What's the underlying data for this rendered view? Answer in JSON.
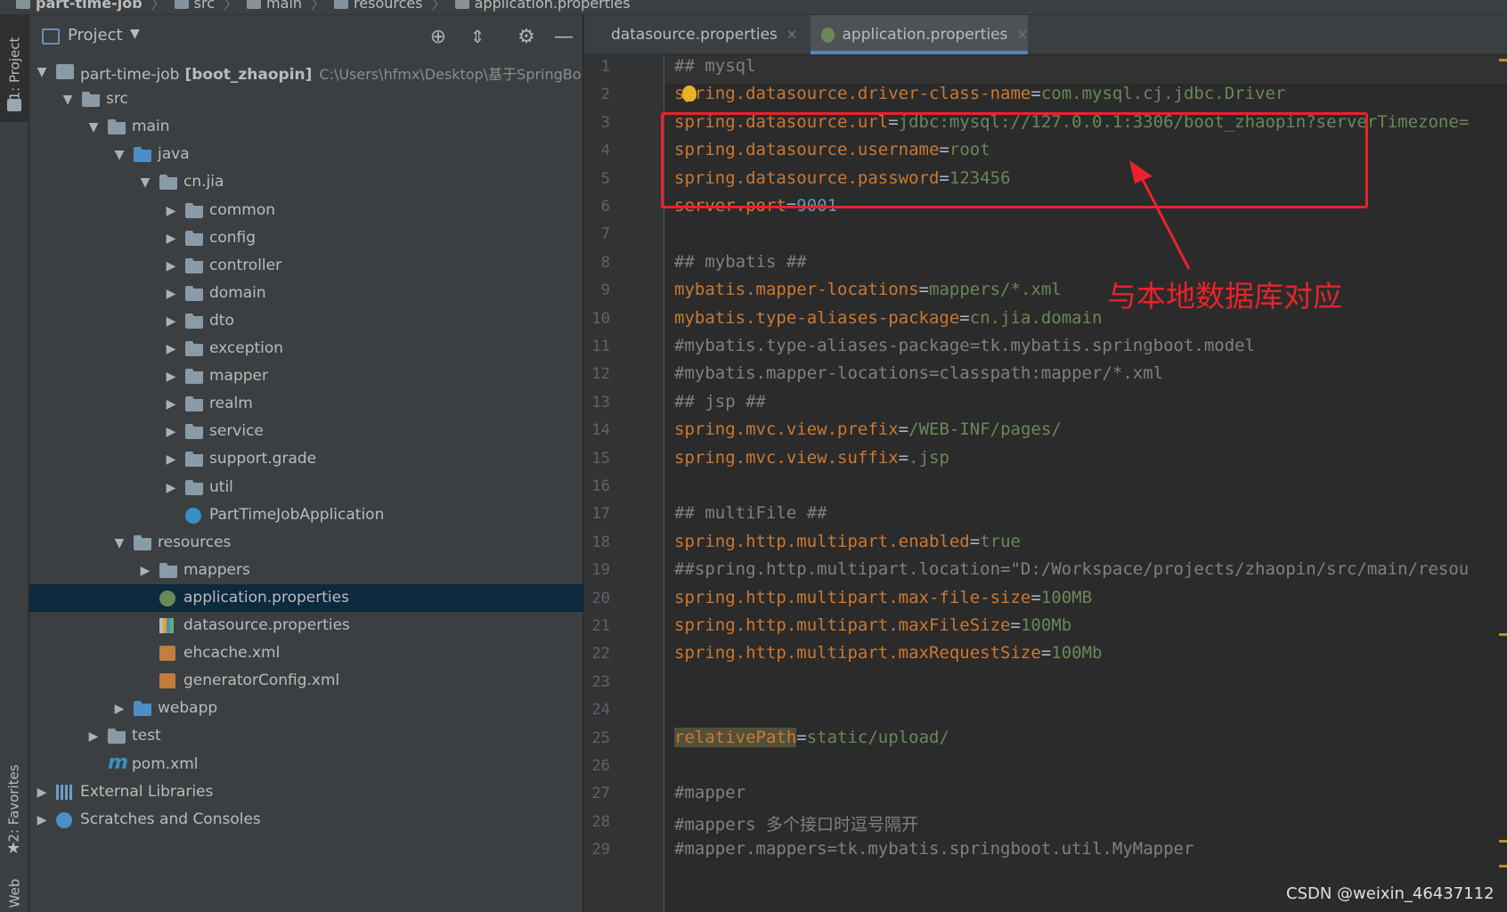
{
  "breadcrumb": {
    "items": [
      "part-time-job",
      "src",
      "main",
      "resources",
      "application.properties"
    ]
  },
  "left_strip": {
    "project_tab": "1: Project",
    "favorites_tab": "2: Favorites",
    "web_tab": "Web"
  },
  "project_panel": {
    "title": "Project",
    "buttons": [
      "locate-icon",
      "collapse-icon",
      "gear-icon",
      "minimize-icon"
    ],
    "tree": [
      {
        "label": "part-time-job",
        "bold": "[boot_zhaopin]",
        "path": "C:\\Users\\hfmx\\Desktop\\基于SpringBo"
      },
      {
        "label": "src"
      },
      {
        "label": "main"
      },
      {
        "label": "java"
      },
      {
        "label": "cn.jia"
      },
      {
        "label": "common"
      },
      {
        "label": "config"
      },
      {
        "label": "controller"
      },
      {
        "label": "domain"
      },
      {
        "label": "dto"
      },
      {
        "label": "exception"
      },
      {
        "label": "mapper"
      },
      {
        "label": "realm"
      },
      {
        "label": "service"
      },
      {
        "label": "support.grade"
      },
      {
        "label": "util"
      },
      {
        "label": "PartTimeJobApplication"
      },
      {
        "label": "resources"
      },
      {
        "label": "mappers"
      },
      {
        "label": "application.properties"
      },
      {
        "label": "datasource.properties"
      },
      {
        "label": "ehcache.xml"
      },
      {
        "label": "generatorConfig.xml"
      },
      {
        "label": "webapp"
      },
      {
        "label": "test"
      },
      {
        "label": "pom.xml"
      },
      {
        "label": "External Libraries"
      },
      {
        "label": "Scratches and Consoles"
      }
    ]
  },
  "tabs": [
    {
      "label": "datasource.properties",
      "active": false
    },
    {
      "label": "application.properties",
      "active": true
    }
  ],
  "editor": {
    "lines": [
      [
        {
          "t": "c",
          "s": "## mysql"
        }
      ],
      [
        {
          "t": "k",
          "s": "spring.datasource.driver-class-name"
        },
        {
          "t": "eq",
          "s": "="
        },
        {
          "t": "v",
          "s": "com.mysql.cj.jdbc.Driver"
        }
      ],
      [
        {
          "t": "k",
          "s": "spring.datasource.url"
        },
        {
          "t": "eq",
          "s": "="
        },
        {
          "t": "v",
          "s": "jdbc:mysql://127.0.0.1:3306/boot_zhaopin?serverTimezone="
        }
      ],
      [
        {
          "t": "k",
          "s": "spring.datasource.username"
        },
        {
          "t": "eq",
          "s": "="
        },
        {
          "t": "v",
          "s": "root"
        }
      ],
      [
        {
          "t": "k",
          "s": "spring.datasource.password"
        },
        {
          "t": "eq",
          "s": "="
        },
        {
          "t": "v",
          "s": "123456"
        }
      ],
      [
        {
          "t": "k",
          "s": "server.port"
        },
        {
          "t": "eq",
          "s": "="
        },
        {
          "t": "n",
          "s": "9001"
        }
      ],
      [],
      [
        {
          "t": "c",
          "s": "## mybatis ##"
        }
      ],
      [
        {
          "t": "k",
          "s": "mybatis.mapper-locations"
        },
        {
          "t": "eq",
          "s": "="
        },
        {
          "t": "v",
          "s": "mappers/*.xml"
        }
      ],
      [
        {
          "t": "k",
          "s": "mybatis.type-aliases-package"
        },
        {
          "t": "eq",
          "s": "="
        },
        {
          "t": "v",
          "s": "cn.jia.domain"
        }
      ],
      [
        {
          "t": "c",
          "s": "#mybatis.type-aliases-package=tk.mybatis.springboot.model"
        }
      ],
      [
        {
          "t": "c",
          "s": "#mybatis.mapper-locations=classpath:mapper/*.xml"
        }
      ],
      [
        {
          "t": "c",
          "s": "## jsp ##"
        }
      ],
      [
        {
          "t": "k",
          "s": "spring.mvc.view.prefix"
        },
        {
          "t": "eq",
          "s": "="
        },
        {
          "t": "v",
          "s": "/WEB-INF/pages/"
        }
      ],
      [
        {
          "t": "k",
          "s": "spring.mvc.view.suffix"
        },
        {
          "t": "eq",
          "s": "="
        },
        {
          "t": "v",
          "s": ".jsp"
        }
      ],
      [],
      [
        {
          "t": "c",
          "s": "## multiFile ##"
        }
      ],
      [
        {
          "t": "k",
          "s": "spring.http.multipart.enabled"
        },
        {
          "t": "eq",
          "s": "="
        },
        {
          "t": "v",
          "s": "true"
        }
      ],
      [
        {
          "t": "c",
          "s": "##spring.http.multipart.location=\"D:/Workspace/projects/zhaopin/src/main/resou"
        }
      ],
      [
        {
          "t": "k",
          "s": "spring.http.multipart.max-file-size"
        },
        {
          "t": "eq",
          "s": "="
        },
        {
          "t": "v",
          "s": "100MB"
        }
      ],
      [
        {
          "t": "k",
          "s": "spring.http.multipart.maxFileSize"
        },
        {
          "t": "eq",
          "s": "="
        },
        {
          "t": "v",
          "s": "100Mb"
        }
      ],
      [
        {
          "t": "k",
          "s": "spring.http.multipart.maxRequestSize"
        },
        {
          "t": "eq",
          "s": "="
        },
        {
          "t": "v",
          "s": "100Mb"
        }
      ],
      [],
      [],
      [
        {
          "t": "k hl",
          "s": "relativePath"
        },
        {
          "t": "eq",
          "s": "="
        },
        {
          "t": "v",
          "s": "static/upload/"
        }
      ],
      [],
      [
        {
          "t": "c",
          "s": "#mapper"
        }
      ],
      [
        {
          "t": "c",
          "s": "#mappers 多个接口时逗号隔开"
        }
      ],
      [
        {
          "t": "c",
          "s": "#mapper.mappers=tk.mybatis.springboot.util.MyMapper"
        }
      ]
    ]
  },
  "annotation": "与本地数据库对应",
  "watermark": "CSDN @weixin_46437112",
  "colors": {
    "key": "#cc7832",
    "value": "#6a8759",
    "comment": "#808080",
    "number": "#6897bb",
    "highlight": "#e8232b",
    "tab_underline": "#4a88c7",
    "selection": "#0d293e"
  }
}
